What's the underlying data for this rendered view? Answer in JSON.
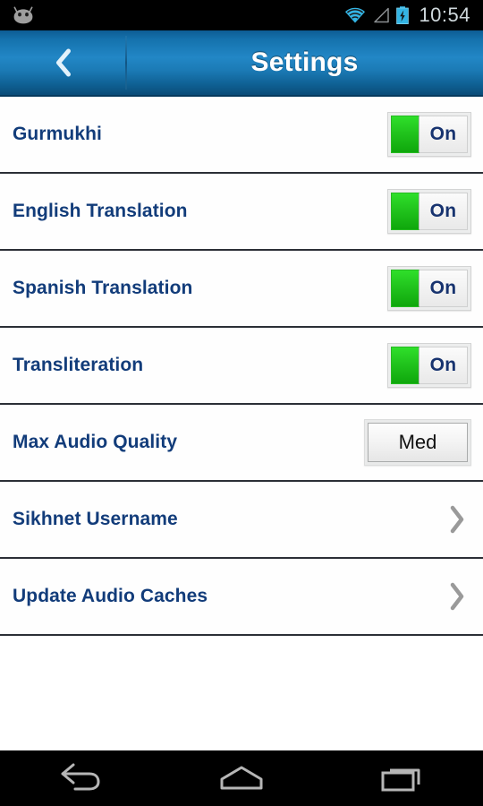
{
  "status_bar": {
    "android_icon": "android-head-icon",
    "wifi_icon": "wifi-icon",
    "signal_icon": "cellular-signal-icon",
    "battery_icon": "battery-charging-icon",
    "time": "10:54"
  },
  "title_bar": {
    "back_icon": "chevron-left-icon",
    "title": "Settings"
  },
  "rows": [
    {
      "label": "Gurmukhi",
      "control": "toggle",
      "value": "On"
    },
    {
      "label": "English Translation",
      "control": "toggle",
      "value": "On"
    },
    {
      "label": "Spanish Translation",
      "control": "toggle",
      "value": "On"
    },
    {
      "label": "Transliteration",
      "control": "toggle",
      "value": "On"
    },
    {
      "label": "Max Audio Quality",
      "control": "button",
      "value": "Med"
    },
    {
      "label": "Sikhnet Username",
      "control": "chevron",
      "value": ""
    },
    {
      "label": "Update Audio Caches",
      "control": "chevron",
      "value": ""
    }
  ],
  "nav_bar": {
    "back": "nav-back-icon",
    "home": "nav-home-icon",
    "recents": "nav-recents-icon"
  },
  "colors": {
    "title_bar_blue": "#2287c6",
    "label_navy": "#123c7a",
    "toggle_green": "#21c41d",
    "separator": "#2b2f36",
    "status_bar_black": "#000000",
    "clock_grey": "#cfd8dc",
    "chevron_grey": "#9a9a9a"
  }
}
